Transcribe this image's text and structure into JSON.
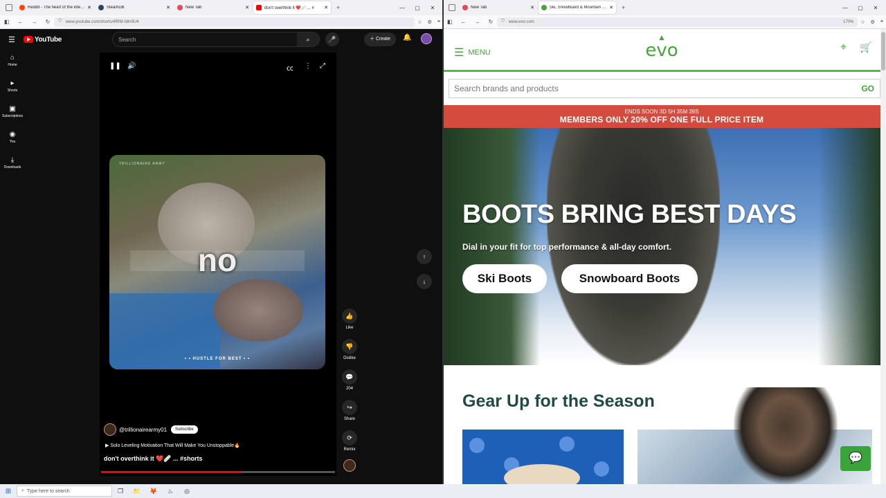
{
  "left_window": {
    "tabs": [
      {
        "title": "Reddit - The heart of the internet",
        "color": "#ff4500"
      },
      {
        "title": "SteamDB",
        "color": "#2a475e"
      },
      {
        "title": "New Tab",
        "color": "#e04b5a"
      },
      {
        "title": "don't overthink it ❤️🩹 ... #",
        "color": "#ff0000"
      }
    ],
    "url": "www.youtube.com/shorts/4RIM-h8n9U4"
  },
  "youtube": {
    "logo": "YouTube",
    "search_placeholder": "Search",
    "create_label": "Create",
    "sidebar": [
      {
        "label": "Home",
        "icon": "⌂"
      },
      {
        "label": "Shorts",
        "icon": "▸"
      },
      {
        "label": "Subscriptions",
        "icon": "▣"
      },
      {
        "label": "You",
        "icon": "◉"
      },
      {
        "label": "Downloads",
        "icon": "⤓"
      }
    ],
    "video_big_text": "no",
    "video_top_text": "TRILLIONAIRE ARMY",
    "video_bottom_text": "• • HUSTLE FOR BEST • •",
    "channel": "@trillionairearmy01",
    "subscribe_label": "Subscribe",
    "music_line": "▶ Solo Leveling Motivation That Will Make You Unstoppable🔥",
    "title": "don't overthink it ❤️🩹 ... #shorts",
    "progress": 0.6,
    "actions": {
      "like": "Like",
      "dislike": "Dislike",
      "comments": "204",
      "share": "Share",
      "remix": "Remix"
    }
  },
  "right_window": {
    "tabs": [
      {
        "title": "New Tab",
        "color": "#e04b5a"
      },
      {
        "title": "Ski, Snowboard & Mountain Bike",
        "color": "#4aa23d"
      }
    ],
    "url": "www.evo.com",
    "zoom": "170%"
  },
  "evo": {
    "menu_label": "MENU",
    "logo": "evo",
    "search_placeholder": "Search brands and products",
    "go_label": "GO",
    "countdown": "ENDS SOON   3D 5H 35M 39S",
    "promo_text": "MEMBERS ONLY 20% OFF ONE FULL PRICE ITEM",
    "hero_title": "BOOTS BRING BEST DAYS",
    "hero_sub": "Dial in your fit for top performance & all-day comfort.",
    "btn_ski": "Ski Boots",
    "btn_snowboard": "Snowboard Boots",
    "section_title": "Gear Up for the Season",
    "colors": {
      "brand_green": "#4aa23d",
      "promo_red": "#d44a3c"
    }
  },
  "taskbar": {
    "search_placeholder": "Type here to search"
  }
}
